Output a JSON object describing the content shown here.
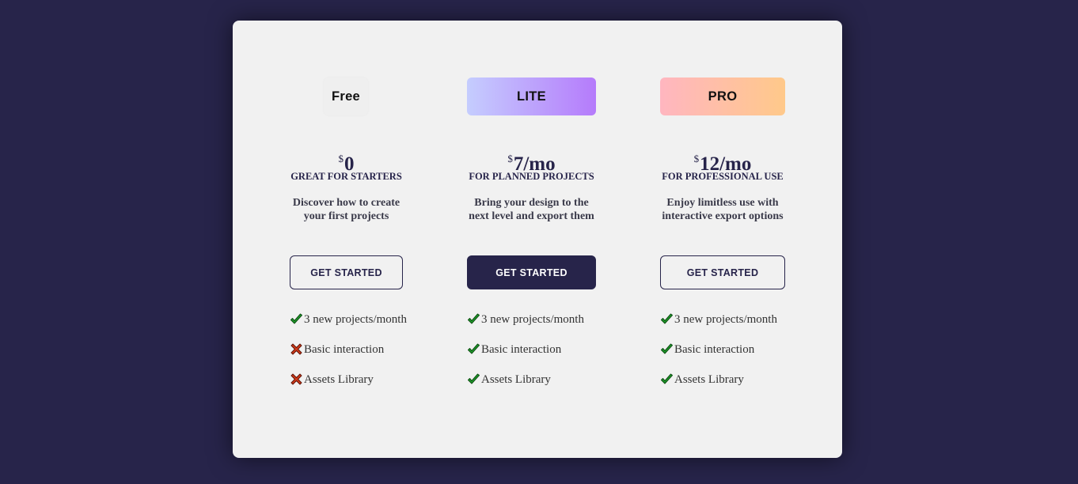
{
  "plans": [
    {
      "badge": "Free",
      "currency": "$",
      "price": "0",
      "subtitle": "GREAT FOR STARTERS",
      "description_line1": "Discover how to create",
      "description_line2": "your first projects",
      "cta": "GET STARTED",
      "features": [
        {
          "label": "3 new projects/month",
          "included": true,
          "icon": "check-icon"
        },
        {
          "label": "Basic interaction",
          "included": false,
          "icon": "cross-icon"
        },
        {
          "label": "Assets Library",
          "included": false,
          "icon": "cross-icon"
        }
      ]
    },
    {
      "badge": "LITE",
      "badge_gradient": [
        "#c5cdfe",
        "#b57bfb"
      ],
      "currency": "$",
      "price": "7/mo",
      "subtitle": "FOR PLANNED PROJECTS",
      "description_line1": "Bring your design to the",
      "description_line2": "next level and export them",
      "cta": "GET STARTED",
      "features": [
        {
          "label": "3 new projects/month",
          "included": true,
          "icon": "check-icon"
        },
        {
          "label": "Basic interaction",
          "included": true,
          "icon": "check-icon"
        },
        {
          "label": "Assets Library",
          "included": true,
          "icon": "check-icon"
        }
      ]
    },
    {
      "badge": "PRO",
      "badge_gradient": [
        "#ffb6c0",
        "#ffc98a"
      ],
      "currency": "$",
      "price": "12/mo",
      "subtitle": "FOR PROFESSIONAL USE",
      "description_line1": "Enjoy limitless use with",
      "description_line2": "interactive export options",
      "cta": "GET STARTED",
      "features": [
        {
          "label": "3 new projects/month",
          "included": true,
          "icon": "check-icon"
        },
        {
          "label": "Basic interaction",
          "included": true,
          "icon": "check-icon"
        },
        {
          "label": "Assets Library",
          "included": true,
          "icon": "check-icon"
        }
      ]
    }
  ],
  "colors": {
    "background": "#27244a",
    "card": "#f1f1f1",
    "accent": "#27244a",
    "check": "#1e9c2a",
    "cross": "#d23a1a"
  }
}
